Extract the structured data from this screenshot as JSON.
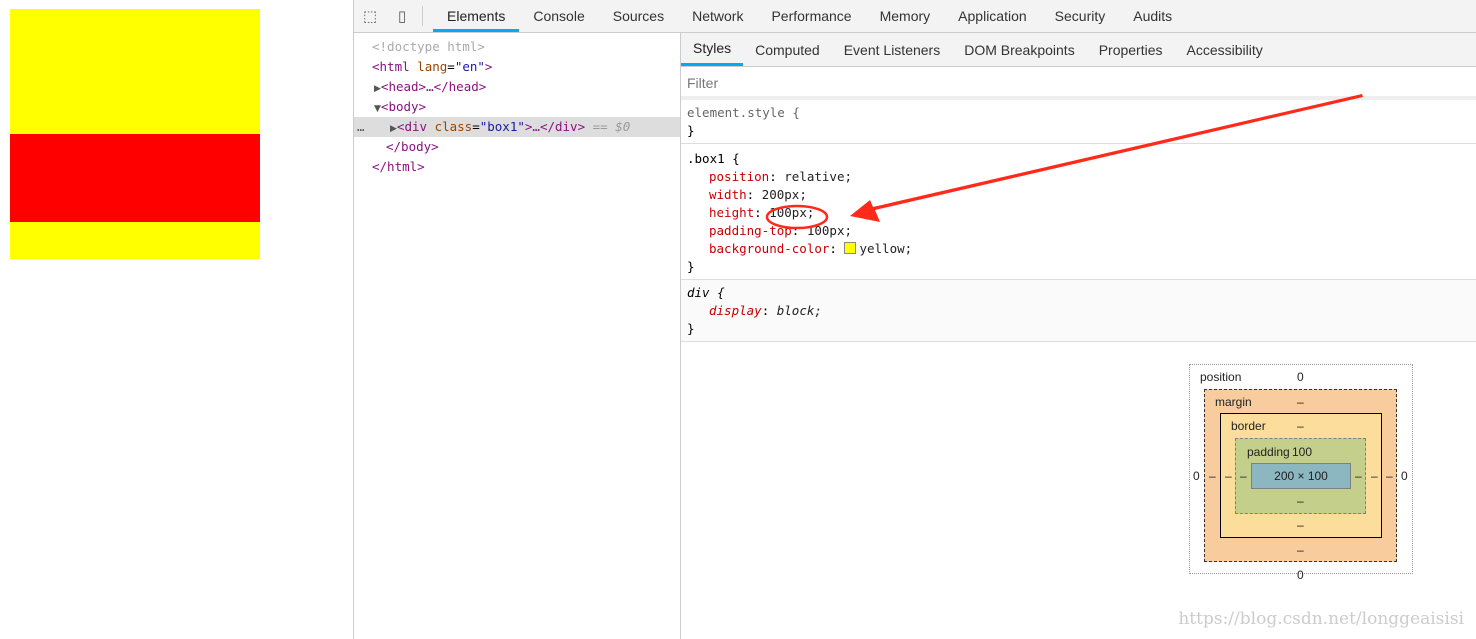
{
  "toolbar": {
    "tabs": [
      "Elements",
      "Console",
      "Sources",
      "Network",
      "Performance",
      "Memory",
      "Application",
      "Security",
      "Audits"
    ],
    "active": "Elements",
    "icons": [
      "inspect-icon",
      "device-toggle-icon"
    ]
  },
  "dom_tree": {
    "doctype": "<!doctype html>",
    "html_open": "<html",
    "lang_attr": "lang",
    "lang_val": "\"en\"",
    "head": "<head>…</head>",
    "body_open": "<body>",
    "div_tag": "<div",
    "div_attr": "class",
    "div_val": "\"box1\"",
    "div_rest": ">…</div>",
    "selected_marker": "== $0",
    "body_close": "</body>",
    "html_close": "</html>",
    "dots": "…"
  },
  "styles": {
    "tabs": [
      "Styles",
      "Computed",
      "Event Listeners",
      "DOM Breakpoints",
      "Properties",
      "Accessibility"
    ],
    "active": "Styles",
    "filter_placeholder": "Filter",
    "element_style": "element.style {",
    "close": "}",
    "box1_selector": ".box1 {",
    "box1_props": [
      {
        "name": "position",
        "value": "relative;"
      },
      {
        "name": "width",
        "value": "200px;"
      },
      {
        "name": "height",
        "value": "100px;"
      },
      {
        "name": "padding-top",
        "value": "100px;"
      },
      {
        "name": "background-color",
        "value": "yellow;",
        "swatch": "#ffff00"
      }
    ],
    "ua_selector": "div {",
    "ua_props": [
      {
        "name": "display",
        "value": "block;"
      }
    ]
  },
  "box_model": {
    "position_label": "position",
    "position_top": "0",
    "position_bottom": "0",
    "position_left": "0",
    "position_right": "0",
    "margin_label": "margin",
    "margin_val": "–",
    "border_label": "border",
    "border_val": "–",
    "padding_label": "padding",
    "padding_top": "100",
    "padding_other": "–",
    "content": "200 × 100"
  },
  "page_preview": {
    "box_color": "#ffff00",
    "overlay_color": "#ff0000"
  },
  "watermark": "https://blog.csdn.net/longgeaisisi",
  "colors": {
    "accent": "#03a9f4",
    "annotation": "#ff2a1a"
  }
}
